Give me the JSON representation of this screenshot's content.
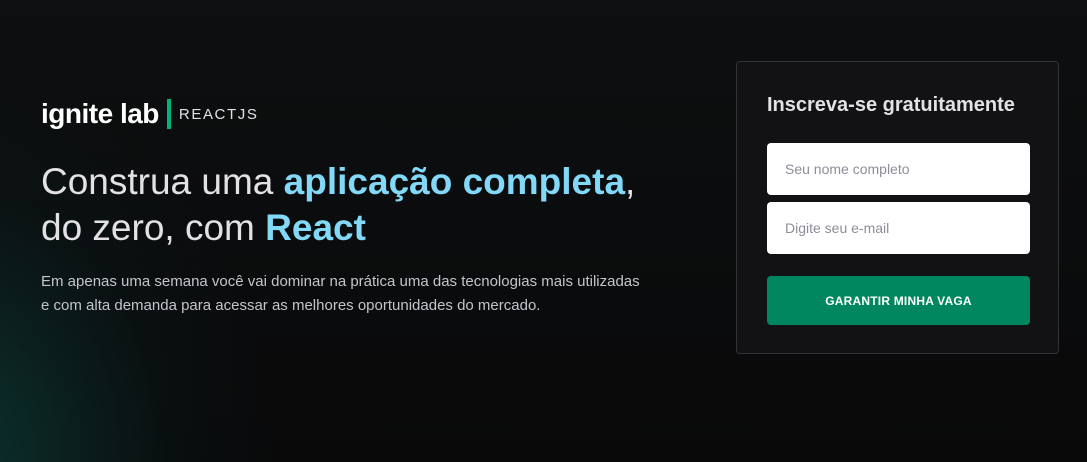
{
  "logo": {
    "brand": "ignite lab",
    "product": "REACTJS"
  },
  "hero": {
    "headline_part1": "Construa uma ",
    "headline_highlight1": "aplicação completa",
    "headline_part2": ",",
    "headline_part3": "do zero, com ",
    "headline_highlight2": "React",
    "description": "Em apenas uma semana você vai dominar na prática uma das tecnologias mais utilizadas e com alta demanda para acessar as melhores oportunidades do mercado."
  },
  "signup": {
    "title": "Inscreva-se gratuitamente",
    "name_placeholder": "Seu nome completo",
    "name_value": "",
    "email_placeholder": "Digite seu e-mail",
    "email_value": "",
    "submit_label": "GARANTIR MINHA VAGA"
  },
  "colors": {
    "accent_green": "#00b37e",
    "button_green": "#00875f",
    "highlight_blue": "#81d8f7",
    "card_bg": "#121214",
    "card_border": "#323238"
  }
}
